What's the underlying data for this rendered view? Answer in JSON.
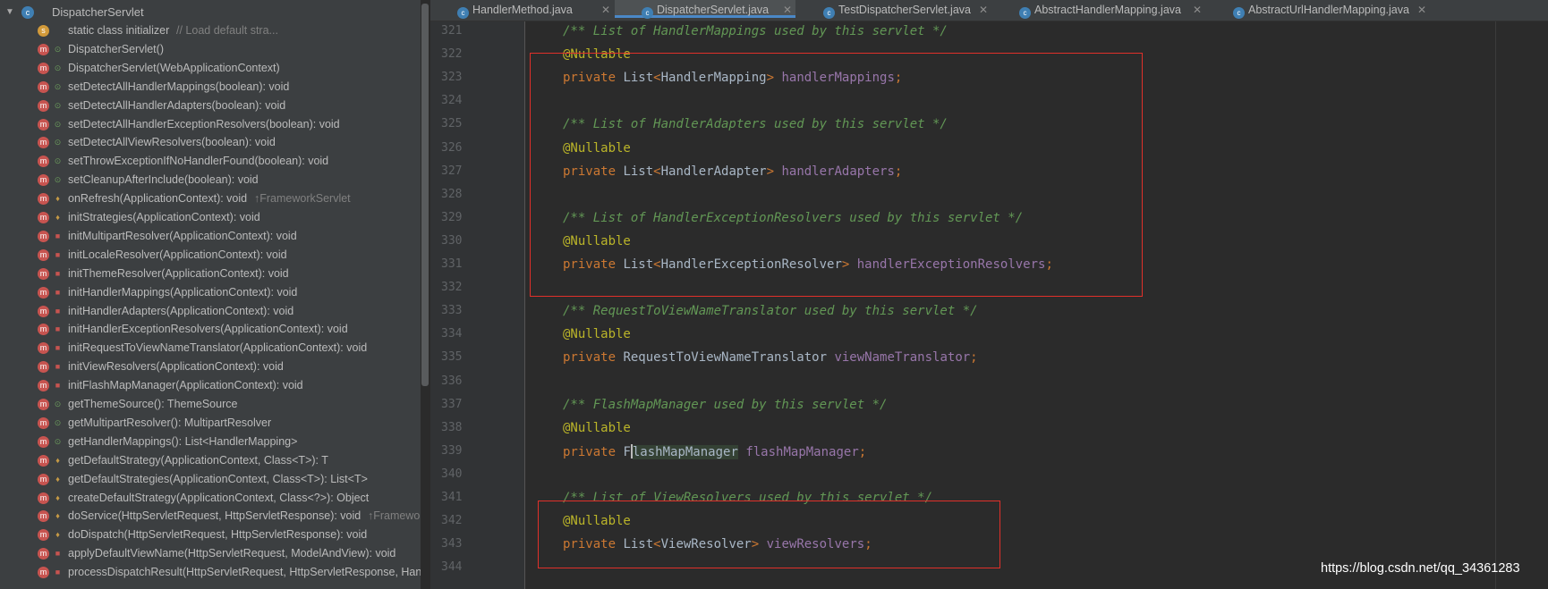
{
  "structure": {
    "root": {
      "label": "DispatcherServlet",
      "icon": "class-icon"
    },
    "items": [
      {
        "label": "static class initializer",
        "hint": "// Load default stra...",
        "kind": "static",
        "vis": ""
      },
      {
        "label": "DispatcherServlet()",
        "hint": "",
        "kind": "method",
        "vis": "public"
      },
      {
        "label": "DispatcherServlet(WebApplicationContext)",
        "hint": "",
        "kind": "method",
        "vis": "public"
      },
      {
        "label": "setDetectAllHandlerMappings(boolean): void",
        "hint": "",
        "kind": "method",
        "vis": "public"
      },
      {
        "label": "setDetectAllHandlerAdapters(boolean): void",
        "hint": "",
        "kind": "method",
        "vis": "public"
      },
      {
        "label": "setDetectAllHandlerExceptionResolvers(boolean): void",
        "hint": "",
        "kind": "method",
        "vis": "public"
      },
      {
        "label": "setDetectAllViewResolvers(boolean): void",
        "hint": "",
        "kind": "method",
        "vis": "public"
      },
      {
        "label": "setThrowExceptionIfNoHandlerFound(boolean): void",
        "hint": "",
        "kind": "method",
        "vis": "public"
      },
      {
        "label": "setCleanupAfterInclude(boolean): void",
        "hint": "",
        "kind": "method",
        "vis": "public"
      },
      {
        "label": "onRefresh(ApplicationContext): void",
        "hint": "↑FrameworkServlet",
        "kind": "method",
        "vis": "protected"
      },
      {
        "label": "initStrategies(ApplicationContext): void",
        "hint": "",
        "kind": "method",
        "vis": "protected"
      },
      {
        "label": "initMultipartResolver(ApplicationContext): void",
        "hint": "",
        "kind": "method",
        "vis": "private"
      },
      {
        "label": "initLocaleResolver(ApplicationContext): void",
        "hint": "",
        "kind": "method",
        "vis": "private"
      },
      {
        "label": "initThemeResolver(ApplicationContext): void",
        "hint": "",
        "kind": "method",
        "vis": "private"
      },
      {
        "label": "initHandlerMappings(ApplicationContext): void",
        "hint": "",
        "kind": "method",
        "vis": "private"
      },
      {
        "label": "initHandlerAdapters(ApplicationContext): void",
        "hint": "",
        "kind": "method",
        "vis": "private"
      },
      {
        "label": "initHandlerExceptionResolvers(ApplicationContext): void",
        "hint": "",
        "kind": "method",
        "vis": "private"
      },
      {
        "label": "initRequestToViewNameTranslator(ApplicationContext): void",
        "hint": "",
        "kind": "method",
        "vis": "private"
      },
      {
        "label": "initViewResolvers(ApplicationContext): void",
        "hint": "",
        "kind": "method",
        "vis": "private"
      },
      {
        "label": "initFlashMapManager(ApplicationContext): void",
        "hint": "",
        "kind": "method",
        "vis": "private"
      },
      {
        "label": "getThemeSource(): ThemeSource",
        "hint": "",
        "kind": "method",
        "vis": "public"
      },
      {
        "label": "getMultipartResolver(): MultipartResolver",
        "hint": "",
        "kind": "method",
        "vis": "public"
      },
      {
        "label": "getHandlerMappings(): List<HandlerMapping>",
        "hint": "",
        "kind": "method",
        "vis": "public"
      },
      {
        "label": "getDefaultStrategy(ApplicationContext, Class<T>): T",
        "hint": "",
        "kind": "method",
        "vis": "protected"
      },
      {
        "label": "getDefaultStrategies(ApplicationContext, Class<T>): List<T>",
        "hint": "",
        "kind": "method",
        "vis": "protected"
      },
      {
        "label": "createDefaultStrategy(ApplicationContext, Class<?>): Object",
        "hint": "",
        "kind": "method",
        "vis": "protected"
      },
      {
        "label": "doService(HttpServletRequest, HttpServletResponse): void",
        "hint": "↑Framewor",
        "kind": "method",
        "vis": "protected"
      },
      {
        "label": "doDispatch(HttpServletRequest, HttpServletResponse): void",
        "hint": "",
        "kind": "method",
        "vis": "protected"
      },
      {
        "label": "applyDefaultViewName(HttpServletRequest, ModelAndView): void",
        "hint": "",
        "kind": "method",
        "vis": "private"
      },
      {
        "label": "processDispatchResult(HttpServletRequest, HttpServletResponse, Han",
        "hint": "",
        "kind": "method",
        "vis": "private"
      }
    ]
  },
  "tabs": [
    {
      "label": "HandlerMethod.java",
      "active": false
    },
    {
      "label": "DispatcherServlet.java",
      "active": true
    },
    {
      "label": "TestDispatcherServlet.java",
      "active": false
    },
    {
      "label": "AbstractHandlerMapping.java",
      "active": false
    },
    {
      "label": "AbstractUrlHandlerMapping.java",
      "active": false
    }
  ],
  "editor": {
    "lines": [
      {
        "num": "321",
        "tokens": [
          [
            "comment",
            "/** List of HandlerMappings used by this servlet */"
          ]
        ]
      },
      {
        "num": "322",
        "tokens": [
          [
            "anno",
            "@Nullable"
          ]
        ]
      },
      {
        "num": "323",
        "tokens": [
          [
            "kw",
            "private "
          ],
          [
            "type",
            "List"
          ],
          [
            "punct",
            "<"
          ],
          [
            "type",
            "HandlerMapping"
          ],
          [
            "punct",
            "> "
          ],
          [
            "field",
            "handlerMappings"
          ],
          [
            "punct",
            ";"
          ]
        ]
      },
      {
        "num": "324",
        "tokens": []
      },
      {
        "num": "325",
        "tokens": [
          [
            "comment",
            "/** List of HandlerAdapters used by this servlet */"
          ]
        ]
      },
      {
        "num": "326",
        "tokens": [
          [
            "anno",
            "@Nullable"
          ]
        ]
      },
      {
        "num": "327",
        "tokens": [
          [
            "kw",
            "private "
          ],
          [
            "type",
            "List"
          ],
          [
            "punct",
            "<"
          ],
          [
            "type",
            "HandlerAdapter"
          ],
          [
            "punct",
            "> "
          ],
          [
            "field",
            "handlerAdapters"
          ],
          [
            "punct",
            ";"
          ]
        ]
      },
      {
        "num": "328",
        "tokens": []
      },
      {
        "num": "329",
        "tokens": [
          [
            "comment",
            "/** List of HandlerExceptionResolvers used by this servlet */"
          ]
        ]
      },
      {
        "num": "330",
        "tokens": [
          [
            "anno",
            "@Nullable"
          ]
        ]
      },
      {
        "num": "331",
        "tokens": [
          [
            "kw",
            "private "
          ],
          [
            "type",
            "List"
          ],
          [
            "punct",
            "<"
          ],
          [
            "type",
            "HandlerExceptionResolver"
          ],
          [
            "punct",
            "> "
          ],
          [
            "field",
            "handlerExceptionResolvers"
          ],
          [
            "punct",
            ";"
          ]
        ]
      },
      {
        "num": "332",
        "tokens": []
      },
      {
        "num": "333",
        "tokens": [
          [
            "comment",
            "/** RequestToViewNameTranslator used by this servlet */"
          ]
        ]
      },
      {
        "num": "334",
        "tokens": [
          [
            "anno",
            "@Nullable"
          ]
        ]
      },
      {
        "num": "335",
        "tokens": [
          [
            "kw",
            "private "
          ],
          [
            "type",
            "RequestToViewNameTranslator "
          ],
          [
            "field",
            "viewNameTranslator"
          ],
          [
            "punct",
            ";"
          ]
        ]
      },
      {
        "num": "336",
        "tokens": []
      },
      {
        "num": "337",
        "tokens": [
          [
            "comment",
            "/** FlashMapManager used by this servlet */"
          ]
        ]
      },
      {
        "num": "338",
        "tokens": [
          [
            "anno",
            "@Nullable"
          ]
        ]
      },
      {
        "num": "339",
        "tokens": [
          [
            "kw",
            "private "
          ],
          [
            "type",
            "F"
          ],
          [
            "caret",
            ""
          ],
          [
            "hl",
            "lashMapManager"
          ],
          [
            "type",
            " "
          ],
          [
            "field",
            "flashMapManager"
          ],
          [
            "punct",
            ";"
          ]
        ]
      },
      {
        "num": "340",
        "tokens": []
      },
      {
        "num": "341",
        "tokens": [
          [
            "comment",
            "/** List of ViewResolvers used by this servlet */"
          ]
        ]
      },
      {
        "num": "342",
        "tokens": [
          [
            "anno",
            "@Nullable"
          ]
        ]
      },
      {
        "num": "343",
        "tokens": [
          [
            "kw",
            "private "
          ],
          [
            "type",
            "List"
          ],
          [
            "punct",
            "<"
          ],
          [
            "type",
            "ViewResolver"
          ],
          [
            "punct",
            "> "
          ],
          [
            "field",
            "viewResolvers"
          ],
          [
            "punct",
            ";"
          ]
        ]
      },
      {
        "num": "344",
        "tokens": []
      }
    ]
  },
  "watermark": "https://blog.csdn.net/qq_34361283",
  "colors": {
    "annotation_box": "#e0302a",
    "active_tab_underline": "#4a88c7"
  }
}
